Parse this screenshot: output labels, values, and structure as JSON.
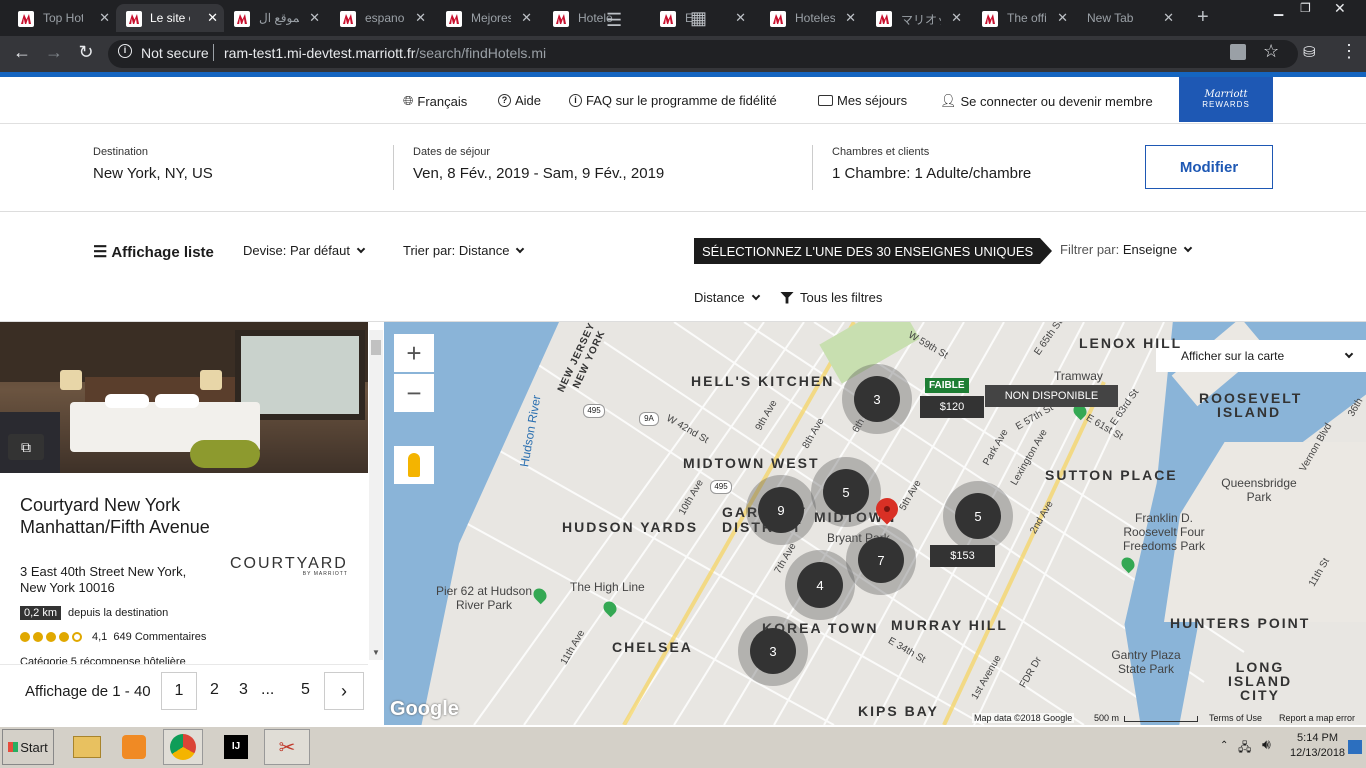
{
  "browser": {
    "tabs": [
      {
        "title": "Top Hote"
      },
      {
        "title": "Le site of"
      },
      {
        "title": "الموقع ال"
      },
      {
        "title": "espanol"
      },
      {
        "title": "Mejores"
      },
      {
        "title": "Hotele"
      },
      {
        "title": "E"
      },
      {
        "title": "Hoteles"
      },
      {
        "title": "マリオット"
      },
      {
        "title": "The offic"
      },
      {
        "title": "New Tab"
      }
    ],
    "security_label": "Not secure",
    "url_host": "ram-test1.mi-devtest.marriott.fr",
    "url_path": "/search/findHotels.mi"
  },
  "header": {
    "language": "Français",
    "help": "Aide",
    "faq": "FAQ sur le programme de fidélité",
    "stays": "Mes séjours",
    "signin": "Se connecter ou devenir membre",
    "rewards_brand": "Marriott",
    "rewards_label": "REWARDS"
  },
  "search": {
    "destination_label": "Destination",
    "destination_value": "New York, NY, US",
    "dates_label": "Dates de séjour",
    "dates_value": "Ven, 8 Fév., 2019 - Sam, 9 Fév., 2019",
    "rooms_label": "Chambres et clients",
    "rooms_value": "1 Chambre: 1 Adulte/chambre",
    "modify_button": "Modifier"
  },
  "filters": {
    "list_view": "Affichage liste",
    "currency_label": "Devise:",
    "currency_value": "Par défaut",
    "sort_label": "Trier par:",
    "sort_value": "Distance",
    "brands_banner": "SÉLECTIONNEZ L'UNE DES 30 ENSEIGNES UNIQUES",
    "filter_label": "Filtrer par:",
    "filter_value": "Enseigne",
    "distance": "Distance",
    "all_filters": "Tous les filtres"
  },
  "hotel": {
    "name": "Courtyard New York Manhattan/Fifth Avenue",
    "brand_logo": "COURTYARD",
    "brand_sub": "BY MARRIOTT",
    "address": "3 East 40th Street New York, New York 10016",
    "distance": "0,2 km",
    "distance_text": "depuis la destination",
    "rating": "4,1",
    "reviews": "649 Commentaires",
    "category": "Catégorie 5 récompense hôtelière",
    "stars": 4
  },
  "pagination": {
    "summary": "Affichage de 1 - 40",
    "pages": [
      "1",
      "2",
      "3",
      "...",
      "5"
    ],
    "next": "›"
  },
  "map": {
    "show_on_map": "Afficher sur la carte",
    "neighborhoods": [
      "LENOX HILL",
      "HELL'S KITCHEN",
      "ROOSEVELT ISLAND",
      "MIDTOWN WEST",
      "SUTTON PLACE",
      "HUDSON YARDS",
      "GARMENT DISTRICT",
      "MIDTOWN",
      "KOREA TOWN",
      "MURRAY HILL",
      "CHELSEA",
      "HUNTERS POINT",
      "LONG ISLAND CITY",
      "KIPS BAY",
      "NEW JERSEY",
      "NEW YORK"
    ],
    "places": [
      "Hudson River",
      "Queensbridge Park",
      "Franklin D. Roosevelt Four Freedoms Park",
      "The High Line",
      "Pier 62 at Hudson River Park",
      "Gantry Plaza State Park",
      "Bryant Park",
      "Tramway"
    ],
    "streets": [
      "W 59th St",
      "W 42nd St",
      "E 65th St",
      "E 57th St",
      "E 63rd St",
      "E 61st St",
      "Vernon Blvd",
      "36th",
      "11th St",
      "10th Ave",
      "11th Ave",
      "9th Ave",
      "8th Ave",
      "7th Ave",
      "6th Ave",
      "5th Ave",
      "Park Ave",
      "Lexington Ave",
      "2nd Ave",
      "1st Avenue",
      "FDR Dr",
      "E 34th St"
    ],
    "shields": [
      "495",
      "9A",
      "495"
    ],
    "clusters": [
      "3",
      "5",
      "9",
      "5",
      "7",
      "4",
      "3"
    ],
    "low_badge": "FAIBLE",
    "prices": [
      "$120",
      "$153"
    ],
    "unavailable": "NON DISPONIBLE",
    "google": "Google",
    "attribution": "Map data ©2018 Google",
    "scale": "500 m",
    "terms": "Terms of Use",
    "report": "Report a map error"
  },
  "taskbar": {
    "start": "Start",
    "time": "5:14 PM",
    "date": "12/13/2018"
  }
}
